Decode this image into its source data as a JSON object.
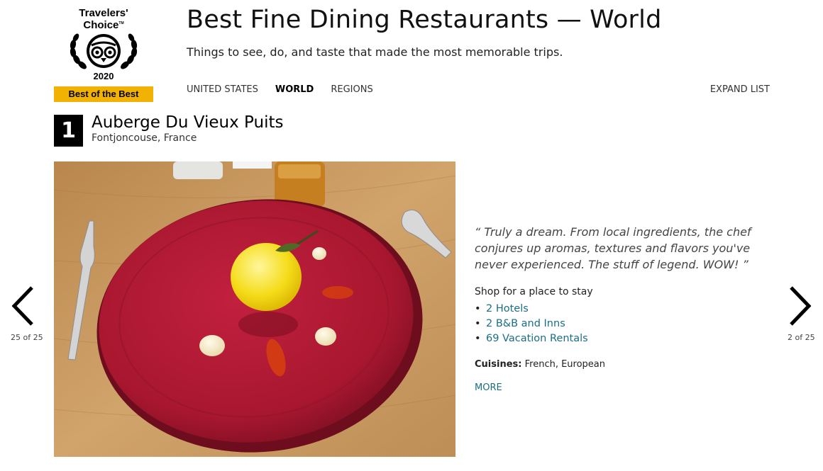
{
  "badge": {
    "line1": "Travelers'",
    "line2": "Choice",
    "trademark": "TM",
    "year": "2020",
    "label": "Best of the Best",
    "bar_color": "#f2b203",
    "icon": "owl-laurel-icon"
  },
  "header": {
    "title": "Best Fine Dining Restaurants — World",
    "subtitle": "Things to see, do, and taste that made the most memorable trips."
  },
  "tabs": [
    {
      "label": "UNITED STATES",
      "active": false
    },
    {
      "label": "WORLD",
      "active": true
    },
    {
      "label": "REGIONS",
      "active": false
    }
  ],
  "expand_list": "EXPAND LIST",
  "listing": {
    "rank": "1",
    "name": "Auberge Du Vieux Puits",
    "location": "Fontjoncouse, France",
    "quote": "“ Truly a dream. From local ingredients, the chef conjures up aromas, textures and flavors you've never experienced. The stuff of legend. WOW! ”",
    "shop_label": "Shop for a place to stay",
    "stays": [
      {
        "label": "2 Hotels"
      },
      {
        "label": "2 B&B and Inns"
      },
      {
        "label": "69 Vacation Rentals"
      }
    ],
    "cuisines_label": "Cuisines:",
    "cuisines": "French, European",
    "more": "MORE"
  },
  "carousel": {
    "prev_count": "25 of 25",
    "next_count": "2 of 25",
    "prev_icon": "chevron-left-icon",
    "next_icon": "chevron-right-icon"
  },
  "colors": {
    "link": "#1a6e86",
    "rank_bg": "#000000",
    "plate": "#b01c34",
    "table": "#c89a5e"
  }
}
